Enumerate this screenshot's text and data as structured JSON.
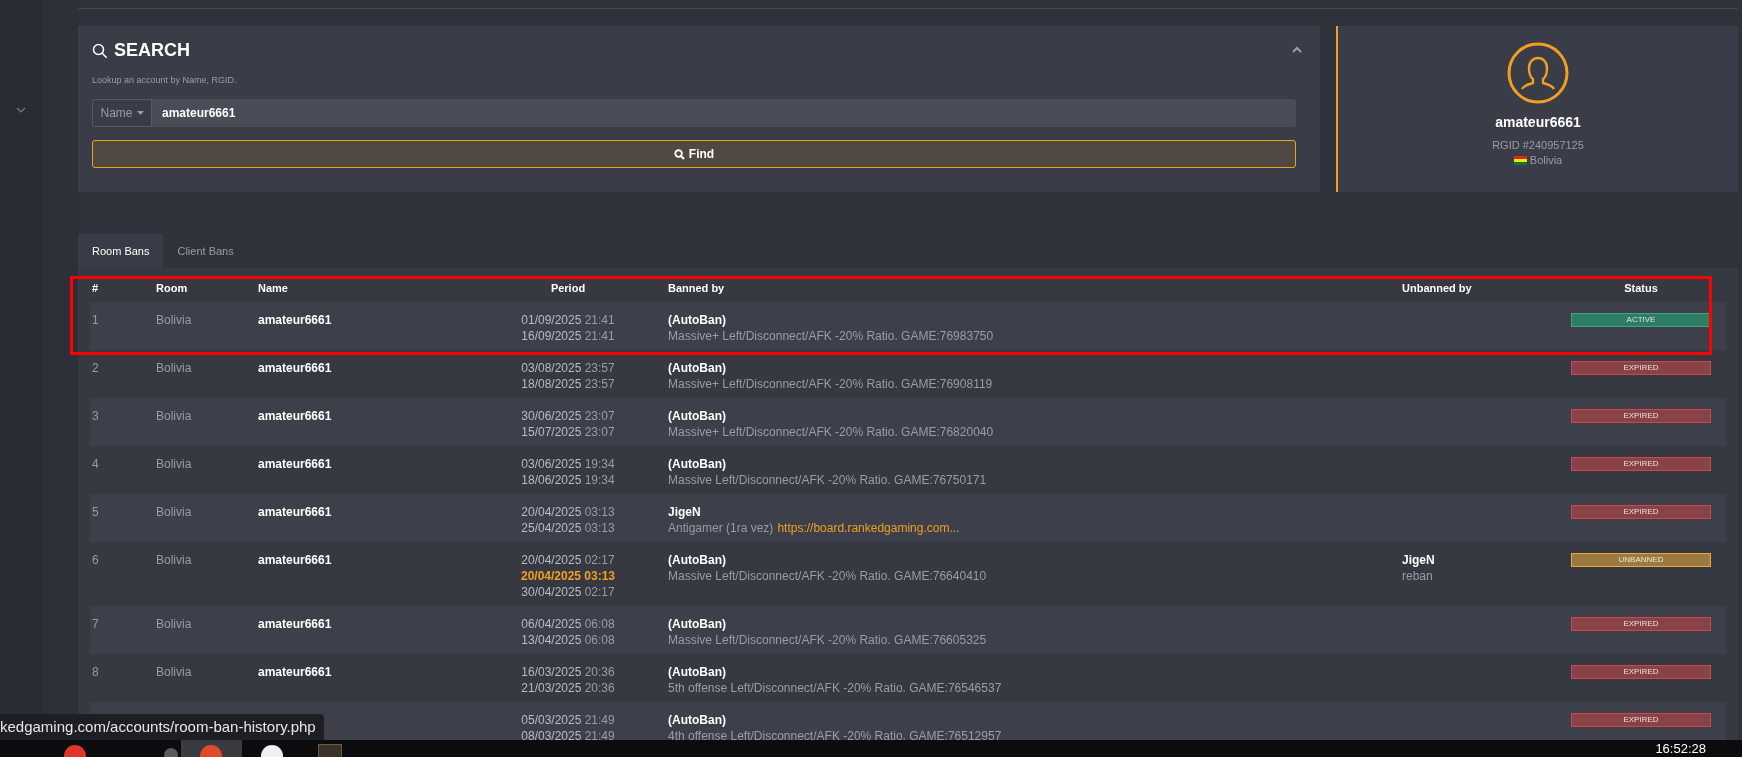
{
  "search": {
    "title": "SEARCH",
    "subtitle": "Lookup an account by Name, RGID.",
    "field_type": "Name",
    "value": "amateur6661",
    "button": "Find"
  },
  "profile": {
    "name": "amateur6661",
    "rgid": "RGID #240957125",
    "country": "Bolivia"
  },
  "tabs": [
    {
      "label": "Room Bans",
      "selected": true
    },
    {
      "label": "Client Bans",
      "selected": false
    }
  ],
  "table": {
    "columns": [
      "#",
      "Room",
      "Name",
      "Period",
      "Banned by",
      "Unbanned by",
      "Status"
    ],
    "rows": [
      {
        "num": "1",
        "room": "Bolivia",
        "name": "amateur6661",
        "period": [
          {
            "date": "01/09/2025",
            "time": "21:41",
            "kind": "start"
          },
          {
            "date": "16/09/2025",
            "time": "21:41",
            "kind": "end"
          }
        ],
        "banned_by": {
          "name": "(AutoBan)",
          "reason": "Massive+ Left/Disconnect/AFK -20% Ratio. GAME:76983750"
        },
        "status": {
          "label": "ACTIVE",
          "kind": "active"
        }
      },
      {
        "num": "2",
        "room": "Bolivia",
        "name": "amateur6661",
        "period": [
          {
            "date": "03/08/2025",
            "time": "23:57",
            "kind": "start"
          },
          {
            "date": "18/08/2025",
            "time": "23:57",
            "kind": "end"
          }
        ],
        "banned_by": {
          "name": "(AutoBan)",
          "reason": "Massive+ Left/Disconnect/AFK -20% Ratio. GAME:76908119"
        },
        "status": {
          "label": "EXPIRED",
          "kind": "expired"
        }
      },
      {
        "num": "3",
        "room": "Bolivia",
        "name": "amateur6661",
        "period": [
          {
            "date": "30/06/2025",
            "time": "23:07",
            "kind": "start"
          },
          {
            "date": "15/07/2025",
            "time": "23:07",
            "kind": "end"
          }
        ],
        "banned_by": {
          "name": "(AutoBan)",
          "reason": "Massive+ Left/Disconnect/AFK -20% Ratio. GAME:76820040"
        },
        "status": {
          "label": "EXPIRED",
          "kind": "expired"
        }
      },
      {
        "num": "4",
        "room": "Bolivia",
        "name": "amateur6661",
        "period": [
          {
            "date": "03/06/2025",
            "time": "19:34",
            "kind": "start"
          },
          {
            "date": "18/06/2025",
            "time": "19:34",
            "kind": "end"
          }
        ],
        "banned_by": {
          "name": "(AutoBan)",
          "reason": "Massive Left/Disconnect/AFK -20% Ratio. GAME:76750171"
        },
        "status": {
          "label": "EXPIRED",
          "kind": "expired"
        }
      },
      {
        "num": "5",
        "room": "Bolivia",
        "name": "amateur6661",
        "period": [
          {
            "date": "20/04/2025",
            "time": "03:13",
            "kind": "start"
          },
          {
            "date": "25/04/2025",
            "time": "03:13",
            "kind": "end"
          }
        ],
        "banned_by": {
          "name": "JigeN",
          "reason": "Antigamer (1ra vez)",
          "link": "https://board.rankedgaming.com..."
        },
        "status": {
          "label": "EXPIRED",
          "kind": "expired"
        }
      },
      {
        "num": "6",
        "room": "Bolivia",
        "name": "amateur6661",
        "period": [
          {
            "date": "20/04/2025",
            "time": "02:17",
            "kind": "start"
          },
          {
            "date": "20/04/2025",
            "time": "03:13",
            "kind": "unban"
          },
          {
            "date": "30/04/2025",
            "time": "02:17",
            "kind": "end"
          }
        ],
        "banned_by": {
          "name": "(AutoBan)",
          "reason": "Massive Left/Disconnect/AFK -20% Ratio. GAME:76640410"
        },
        "unbanned_by": {
          "name": "JigeN",
          "reason": "reban"
        },
        "status": {
          "label": "UNBANNED",
          "kind": "unbanned"
        }
      },
      {
        "num": "7",
        "room": "Bolivia",
        "name": "amateur6661",
        "period": [
          {
            "date": "06/04/2025",
            "time": "06:08",
            "kind": "start"
          },
          {
            "date": "13/04/2025",
            "time": "06:08",
            "kind": "end"
          }
        ],
        "banned_by": {
          "name": "(AutoBan)",
          "reason": "Massive Left/Disconnect/AFK -20% Ratio. GAME:76605325"
        },
        "status": {
          "label": "EXPIRED",
          "kind": "expired"
        }
      },
      {
        "num": "8",
        "room": "Bolivia",
        "name": "amateur6661",
        "period": [
          {
            "date": "16/03/2025",
            "time": "20:36",
            "kind": "start"
          },
          {
            "date": "21/03/2025",
            "time": "20:36",
            "kind": "end"
          }
        ],
        "banned_by": {
          "name": "(AutoBan)",
          "reason": "5th offense Left/Disconnect/AFK -20% Ratio. GAME:76546537"
        },
        "status": {
          "label": "EXPIRED",
          "kind": "expired"
        }
      },
      {
        "period": [
          {
            "date": "05/03/2025",
            "time": "21:49",
            "kind": "start"
          },
          {
            "date": "08/03/2025",
            "time": "21:49",
            "kind": "end"
          }
        ],
        "banned_by": {
          "name": "(AutoBan)",
          "reason": "4th offense Left/Disconnect/AFK -20% Ratio. GAME:76512957"
        },
        "status": {
          "label": "EXPIRED",
          "kind": "expired"
        }
      }
    ]
  },
  "status_url": "kedgaming.com/accounts/room-ban-history.php",
  "taskbar": {
    "clock": "16:52:28"
  }
}
